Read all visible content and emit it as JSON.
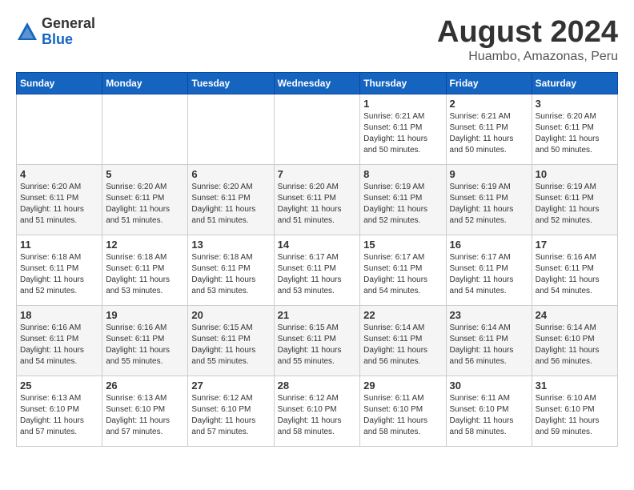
{
  "header": {
    "logo_general": "General",
    "logo_blue": "Blue",
    "month_title": "August 2024",
    "location": "Huambo, Amazonas, Peru"
  },
  "weekdays": [
    "Sunday",
    "Monday",
    "Tuesday",
    "Wednesday",
    "Thursday",
    "Friday",
    "Saturday"
  ],
  "weeks": [
    [
      {
        "day": "",
        "sunrise": "",
        "sunset": "",
        "daylight": ""
      },
      {
        "day": "",
        "sunrise": "",
        "sunset": "",
        "daylight": ""
      },
      {
        "day": "",
        "sunrise": "",
        "sunset": "",
        "daylight": ""
      },
      {
        "day": "",
        "sunrise": "",
        "sunset": "",
        "daylight": ""
      },
      {
        "day": "1",
        "sunrise": "Sunrise: 6:21 AM",
        "sunset": "Sunset: 6:11 PM",
        "daylight": "Daylight: 11 hours and 50 minutes."
      },
      {
        "day": "2",
        "sunrise": "Sunrise: 6:21 AM",
        "sunset": "Sunset: 6:11 PM",
        "daylight": "Daylight: 11 hours and 50 minutes."
      },
      {
        "day": "3",
        "sunrise": "Sunrise: 6:20 AM",
        "sunset": "Sunset: 6:11 PM",
        "daylight": "Daylight: 11 hours and 50 minutes."
      }
    ],
    [
      {
        "day": "4",
        "sunrise": "Sunrise: 6:20 AM",
        "sunset": "Sunset: 6:11 PM",
        "daylight": "Daylight: 11 hours and 51 minutes."
      },
      {
        "day": "5",
        "sunrise": "Sunrise: 6:20 AM",
        "sunset": "Sunset: 6:11 PM",
        "daylight": "Daylight: 11 hours and 51 minutes."
      },
      {
        "day": "6",
        "sunrise": "Sunrise: 6:20 AM",
        "sunset": "Sunset: 6:11 PM",
        "daylight": "Daylight: 11 hours and 51 minutes."
      },
      {
        "day": "7",
        "sunrise": "Sunrise: 6:20 AM",
        "sunset": "Sunset: 6:11 PM",
        "daylight": "Daylight: 11 hours and 51 minutes."
      },
      {
        "day": "8",
        "sunrise": "Sunrise: 6:19 AM",
        "sunset": "Sunset: 6:11 PM",
        "daylight": "Daylight: 11 hours and 52 minutes."
      },
      {
        "day": "9",
        "sunrise": "Sunrise: 6:19 AM",
        "sunset": "Sunset: 6:11 PM",
        "daylight": "Daylight: 11 hours and 52 minutes."
      },
      {
        "day": "10",
        "sunrise": "Sunrise: 6:19 AM",
        "sunset": "Sunset: 6:11 PM",
        "daylight": "Daylight: 11 hours and 52 minutes."
      }
    ],
    [
      {
        "day": "11",
        "sunrise": "Sunrise: 6:18 AM",
        "sunset": "Sunset: 6:11 PM",
        "daylight": "Daylight: 11 hours and 52 minutes."
      },
      {
        "day": "12",
        "sunrise": "Sunrise: 6:18 AM",
        "sunset": "Sunset: 6:11 PM",
        "daylight": "Daylight: 11 hours and 53 minutes."
      },
      {
        "day": "13",
        "sunrise": "Sunrise: 6:18 AM",
        "sunset": "Sunset: 6:11 PM",
        "daylight": "Daylight: 11 hours and 53 minutes."
      },
      {
        "day": "14",
        "sunrise": "Sunrise: 6:17 AM",
        "sunset": "Sunset: 6:11 PM",
        "daylight": "Daylight: 11 hours and 53 minutes."
      },
      {
        "day": "15",
        "sunrise": "Sunrise: 6:17 AM",
        "sunset": "Sunset: 6:11 PM",
        "daylight": "Daylight: 11 hours and 54 minutes."
      },
      {
        "day": "16",
        "sunrise": "Sunrise: 6:17 AM",
        "sunset": "Sunset: 6:11 PM",
        "daylight": "Daylight: 11 hours and 54 minutes."
      },
      {
        "day": "17",
        "sunrise": "Sunrise: 6:16 AM",
        "sunset": "Sunset: 6:11 PM",
        "daylight": "Daylight: 11 hours and 54 minutes."
      }
    ],
    [
      {
        "day": "18",
        "sunrise": "Sunrise: 6:16 AM",
        "sunset": "Sunset: 6:11 PM",
        "daylight": "Daylight: 11 hours and 54 minutes."
      },
      {
        "day": "19",
        "sunrise": "Sunrise: 6:16 AM",
        "sunset": "Sunset: 6:11 PM",
        "daylight": "Daylight: 11 hours and 55 minutes."
      },
      {
        "day": "20",
        "sunrise": "Sunrise: 6:15 AM",
        "sunset": "Sunset: 6:11 PM",
        "daylight": "Daylight: 11 hours and 55 minutes."
      },
      {
        "day": "21",
        "sunrise": "Sunrise: 6:15 AM",
        "sunset": "Sunset: 6:11 PM",
        "daylight": "Daylight: 11 hours and 55 minutes."
      },
      {
        "day": "22",
        "sunrise": "Sunrise: 6:14 AM",
        "sunset": "Sunset: 6:11 PM",
        "daylight": "Daylight: 11 hours and 56 minutes."
      },
      {
        "day": "23",
        "sunrise": "Sunrise: 6:14 AM",
        "sunset": "Sunset: 6:11 PM",
        "daylight": "Daylight: 11 hours and 56 minutes."
      },
      {
        "day": "24",
        "sunrise": "Sunrise: 6:14 AM",
        "sunset": "Sunset: 6:10 PM",
        "daylight": "Daylight: 11 hours and 56 minutes."
      }
    ],
    [
      {
        "day": "25",
        "sunrise": "Sunrise: 6:13 AM",
        "sunset": "Sunset: 6:10 PM",
        "daylight": "Daylight: 11 hours and 57 minutes."
      },
      {
        "day": "26",
        "sunrise": "Sunrise: 6:13 AM",
        "sunset": "Sunset: 6:10 PM",
        "daylight": "Daylight: 11 hours and 57 minutes."
      },
      {
        "day": "27",
        "sunrise": "Sunrise: 6:12 AM",
        "sunset": "Sunset: 6:10 PM",
        "daylight": "Daylight: 11 hours and 57 minutes."
      },
      {
        "day": "28",
        "sunrise": "Sunrise: 6:12 AM",
        "sunset": "Sunset: 6:10 PM",
        "daylight": "Daylight: 11 hours and 58 minutes."
      },
      {
        "day": "29",
        "sunrise": "Sunrise: 6:11 AM",
        "sunset": "Sunset: 6:10 PM",
        "daylight": "Daylight: 11 hours and 58 minutes."
      },
      {
        "day": "30",
        "sunrise": "Sunrise: 6:11 AM",
        "sunset": "Sunset: 6:10 PM",
        "daylight": "Daylight: 11 hours and 58 minutes."
      },
      {
        "day": "31",
        "sunrise": "Sunrise: 6:10 AM",
        "sunset": "Sunset: 6:10 PM",
        "daylight": "Daylight: 11 hours and 59 minutes."
      }
    ]
  ]
}
